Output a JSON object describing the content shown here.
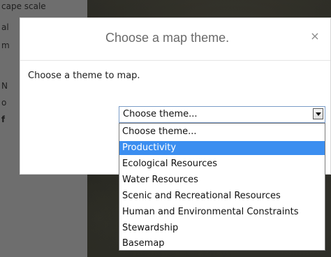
{
  "side_panel": {
    "lines": [
      "cape scale",
      "al",
      "m",
      "N",
      "o",
      "f"
    ]
  },
  "dialog": {
    "title": "Choose a map theme.",
    "close_glyph": "×",
    "prompt": "Choose a theme to map."
  },
  "theme_select": {
    "value": "Choose theme...",
    "options": [
      "Choose theme...",
      "Productivity",
      "Ecological Resources",
      "Water Resources",
      "Scenic and Recreational Resources",
      "Human and Environmental Constraints",
      "Stewardship",
      "Basemap"
    ],
    "highlighted": "Productivity"
  },
  "colors": {
    "highlight": "#3b8ef0",
    "select_border": "#7a9cc8"
  }
}
